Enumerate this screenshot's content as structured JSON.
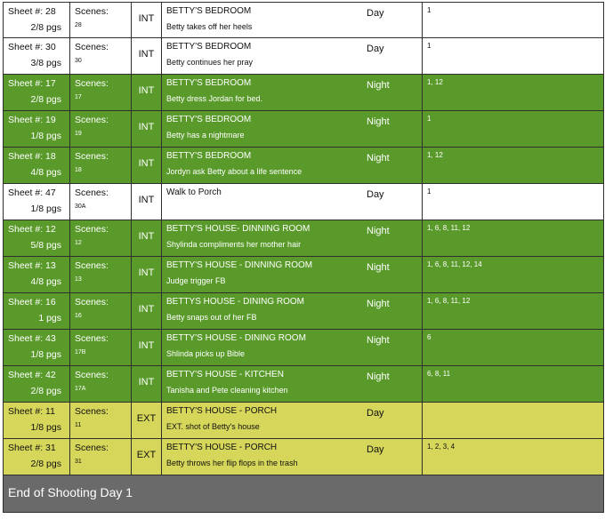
{
  "rows": [
    {
      "sheet": "Sheet #: 28",
      "pages": "2/8  pgs",
      "scenes_label": "Scenes:",
      "scene": "28",
      "ie": "INT",
      "set": "BETTY'S BEDROOM",
      "desc": "Betty takes off her heels",
      "dn": "Day",
      "cast": "1",
      "color": "white"
    },
    {
      "sheet": "Sheet #: 30",
      "pages": "3/8  pgs",
      "scenes_label": "Scenes:",
      "scene": "30",
      "ie": "INT",
      "set": "BETTY'S BEDROOM",
      "desc": "Betty continues her pray",
      "dn": "Day",
      "cast": "1",
      "color": "white"
    },
    {
      "sheet": "Sheet #: 17",
      "pages": "2/8  pgs",
      "scenes_label": "Scenes:",
      "scene": "17",
      "ie": "INT",
      "set": "BETTY'S BEDROOM",
      "desc": "Betty dress Jordan for bed.",
      "dn": "Night",
      "cast": "1, 12",
      "color": "green"
    },
    {
      "sheet": "Sheet #: 19",
      "pages": "1/8  pgs",
      "scenes_label": "Scenes:",
      "scene": "19",
      "ie": "INT",
      "set": "BETTY'S BEDROOM",
      "desc": "Betty has a nightmare",
      "dn": "Night",
      "cast": "1",
      "color": "green"
    },
    {
      "sheet": "Sheet #: 18",
      "pages": "4/8  pgs",
      "scenes_label": "Scenes:",
      "scene": "18",
      "ie": "INT",
      "set": "BETTY'S BEDROOM",
      "desc": "Jordyn ask Betty about a life sentence",
      "dn": "Night",
      "cast": "1, 12",
      "color": "green"
    },
    {
      "sheet": "Sheet #: 47",
      "pages": "1/8  pgs",
      "scenes_label": "Scenes:",
      "scene": "30A",
      "ie": "INT",
      "set": "Walk to Porch",
      "desc": "",
      "dn": "Day",
      "cast": "1",
      "color": "white"
    },
    {
      "sheet": "Sheet #: 12",
      "pages": "5/8  pgs",
      "scenes_label": "Scenes:",
      "scene": "12",
      "ie": "INT",
      "set": "BETTY'S HOUSE- DINNING ROOM",
      "desc": "Shylinda compliments her mother hair",
      "dn": "Night",
      "cast": "1, 6, 8, 11, 12",
      "color": "green"
    },
    {
      "sheet": "Sheet #: 13",
      "pages": "4/8  pgs",
      "scenes_label": "Scenes:",
      "scene": "13",
      "ie": "INT",
      "set": "BETTY'S HOUSE - DINNING ROOM",
      "desc": "Judge trigger FB",
      "dn": "Night",
      "cast": "1, 6, 8, 11, 12, 14",
      "color": "green"
    },
    {
      "sheet": "Sheet #: 16",
      "pages": "1  pgs",
      "scenes_label": "Scenes:",
      "scene": "16",
      "ie": "INT",
      "set": "BETTYS HOUSE - DINING ROOM",
      "desc": "Betty snaps out of her FB",
      "dn": "Night",
      "cast": "1, 6, 8, 11, 12",
      "color": "green"
    },
    {
      "sheet": "Sheet #: 43",
      "pages": "1/8  pgs",
      "scenes_label": "Scenes:",
      "scene": "17B",
      "ie": "INT",
      "set": "BETTY'S HOUSE - DINING ROOM",
      "desc": "Shlinda picks up Bible",
      "dn": "Night",
      "cast": "6",
      "color": "green"
    },
    {
      "sheet": "Sheet #: 42",
      "pages": "2/8  pgs",
      "scenes_label": "Scenes:",
      "scene": "17A",
      "ie": "INT",
      "set": "BETTY'S HOUSE - KITCHEN",
      "desc": "Tanisha and Pete cleaning kitchen",
      "dn": "Night",
      "cast": "6, 8, 11",
      "color": "green"
    },
    {
      "sheet": "Sheet #: 11",
      "pages": "1/8  pgs",
      "scenes_label": "Scenes:",
      "scene": "11",
      "ie": "EXT",
      "set": "BETTY'S HOUSE - PORCH",
      "desc": "EXT. shot of Betty's house",
      "dn": "Day",
      "cast": "",
      "color": "yellow"
    },
    {
      "sheet": "Sheet #: 31",
      "pages": "2/8  pgs",
      "scenes_label": "Scenes:",
      "scene": "31",
      "ie": "EXT",
      "set": "BETTY'S HOUSE - PORCH",
      "desc": "Betty throws her flip flops in the trash",
      "dn": "Day",
      "cast": "1, 2, 3, 4",
      "color": "yellow"
    }
  ],
  "footer": {
    "text": "End of Shooting Day 1"
  },
  "colors": {
    "green": "#5a9a2b",
    "yellow": "#d6d65a",
    "white": "#ffffff",
    "footer": "#6a6a6a"
  }
}
